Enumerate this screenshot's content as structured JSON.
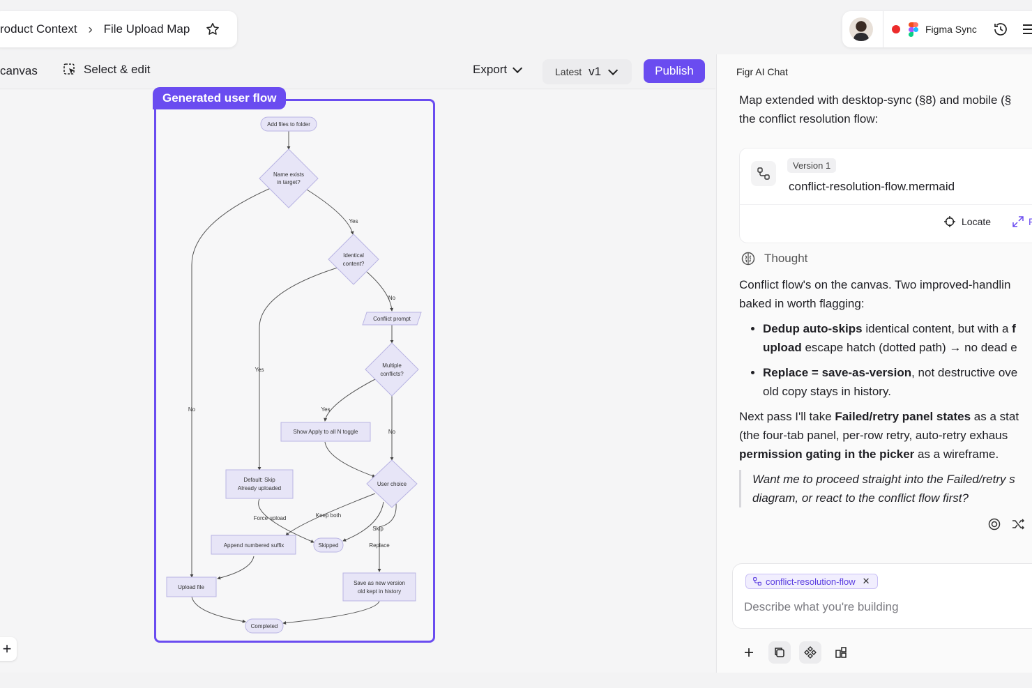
{
  "breadcrumb": {
    "parent": "roduct Context",
    "separator": "›",
    "current": "File Upload Map"
  },
  "topbar": {
    "sync_label": "Figma Sync"
  },
  "toolbar": {
    "canvas_label": "canvas",
    "select_label": "Select & edit",
    "export_label": "Export",
    "latest_label": "Latest",
    "version_label": "v1",
    "publish_label": "Publish"
  },
  "flow": {
    "tag": "Generated user flow",
    "nodes": {
      "add_files": "Add files to folder",
      "name_exists_1": "Name exists",
      "name_exists_2": "in target?",
      "identical_1": "Identical",
      "identical_2": "content?",
      "conflict_prompt": "Conflict prompt",
      "multiple_1": "Multiple",
      "multiple_2": "conflicts?",
      "show_apply": "Show Apply to all N toggle",
      "default_skip_1": "Default: Skip",
      "default_skip_2": "Already uploaded",
      "user_choice": "User choice",
      "append": "Append numbered suffix",
      "skipped": "Skipped",
      "upload_file": "Upload file",
      "save_version_1": "Save as new version",
      "save_version_2": "old kept in history",
      "completed": "Completed"
    },
    "edges": {
      "yes_1": "Yes",
      "no_1": "No",
      "yes_2": "Yes",
      "no_2": "No",
      "yes_3": "Yes",
      "no_3": "No",
      "force_upload": "Force upload",
      "keep_both": "Keep both",
      "skip": "Skip",
      "replace": "Replace"
    }
  },
  "chat": {
    "title": "Figr AI Chat",
    "intro_line1": "Map extended with desktop-sync (§8) and mobile (§",
    "intro_line2": "the conflict resolution flow:",
    "file_card": {
      "version": "Version 1",
      "file_name": "conflict-resolution-flow.mermaid",
      "locate": "Locate",
      "expand": "F"
    },
    "thought_label": "Thought",
    "msg_line1": "Conflict flow's on the canvas. Two improved-handlin",
    "msg_line2": "baked in worth flagging:",
    "b1_bold": "Dedup auto-skips",
    "b1_text": " identical content, but with a ",
    "b1_bold2": "f",
    "b1_bold3": "upload",
    "b1_text2": " escape hatch (dotted path) → no dead e",
    "b2_bold": "Replace = save-as-version",
    "b2_text": ", not destructive ove",
    "b2_line2": "old copy stays in history.",
    "next_text1": "Next pass I'll take ",
    "next_bold1": "Failed/retry panel states",
    "next_text2": " as a stat",
    "next_line2": "(the four-tab panel, per-row retry, auto-retry exhaus",
    "next_bold2": "permission gating in the picker",
    "next_text3": " as a wireframe.",
    "quote_line1": "Want me to proceed straight into the Failed/retry s",
    "quote_line2": "diagram, or react to the conflict flow first?",
    "composer_chip": "conflict-resolution-flow",
    "composer_placeholder": "Describe what you're building"
  },
  "colors": {
    "accent": "#6a4cf0",
    "node_fill": "#e7e5f7",
    "record": "#ec2b2b"
  }
}
